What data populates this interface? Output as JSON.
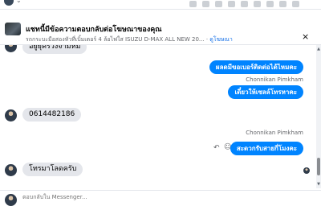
{
  "banner": {
    "title": "แชทนี้มีข้อความตอบกลับต่อโฆษณาของคุณ",
    "subtitle": "รถกระบะมือสองหัวที่เบิ้มเตอร์ 4 ล้อไฟใส ISUZU D-MAX ALL NEW 20...",
    "separator": "·",
    "link": "ดูโฆษณา",
    "close_label": "×"
  },
  "chat": {
    "partial_top_text": "อยู่ยุครัวงจามหม",
    "messages": [
      {
        "id": "out1",
        "text": "ผลดมีขอเบอร์ติดต่อได้ไหมคะ"
      },
      {
        "id": "out2",
        "sender": "Chonnikan Pimkham",
        "text": "เดี๋ยวให้เซลล์โทรหาคะ"
      },
      {
        "id": "in1",
        "text": "0614482186"
      },
      {
        "id": "out3",
        "sender": "Chonnikan Pimkham",
        "text": "สะดวกรับสายกี่โมงคะ"
      },
      {
        "id": "in2",
        "text": "โทรมาโลดครับ"
      }
    ],
    "icons": {
      "reply": "reply-icon",
      "emoji": "emoji-icon",
      "seen": "seen-avatar-icon"
    }
  },
  "composer": {
    "placeholder": "ตอบกลับใน Messenger..."
  },
  "colors": {
    "outgoing_bubble": "#0084ff",
    "incoming_bubble": "#e4e6eb",
    "link": "#1a73e8"
  }
}
